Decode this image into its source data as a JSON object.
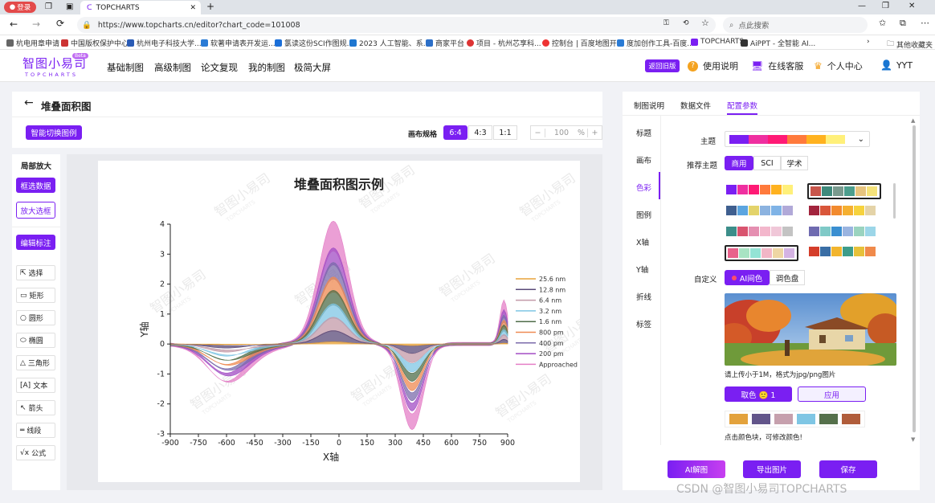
{
  "browser": {
    "login_label": "登录",
    "tab_title": "TOPCHARTS",
    "url": "https://www.topcharts.cn/editor?chart_code=101008",
    "search_placeholder": "点此搜索",
    "bookmarks": [
      "杭电用章申请",
      "中国版权保护中心",
      "杭州电子科技大学...",
      "软著申请表开发运...",
      "氯读这份SCI作图规...",
      "2023 人工智能、系...",
      "商家平台",
      "项目 - 杭州芯享科...",
      "控制台 | 百度地图开...",
      "度加创作工具-百度...",
      "TOPCHARTS",
      "AiPPT - 全智能 AI...",
      "其他收藏夹"
    ]
  },
  "header": {
    "logo_cn": "智图小易司",
    "logo_en": "TOPCHARTS",
    "logo_badge": "Beta",
    "nav": [
      "基础制图",
      "高级制图",
      "论文复现",
      "我的制图",
      "极简大屏"
    ],
    "old_version": "返回旧版",
    "help": "使用说明",
    "service": "在线客服",
    "center": "个人中心",
    "user": "YYT"
  },
  "editor": {
    "back": "←",
    "title": "堆叠面积图",
    "smart_switch": "智能切换图例",
    "ratio_label": "画布规格",
    "ratios": [
      "6:4",
      "4:3",
      "1:1"
    ],
    "zoom_minus": "−",
    "zoom_value": "100",
    "zoom_unit": "%",
    "zoom_plus": "+"
  },
  "left_tools": {
    "title": "局部放大",
    "filter": "框选数据",
    "zoom_box": "放大选框",
    "annotate": "编辑标注",
    "tools": [
      "选择",
      "矩形",
      "圆形",
      "椭圆",
      "三角形",
      "文本",
      "箭头",
      "线段",
      "公式"
    ]
  },
  "chart_data": {
    "type": "area",
    "title": "堆叠面积图示例",
    "xlabel": "X轴",
    "ylabel": "Y轴",
    "xlim": [
      -900,
      900
    ],
    "ylim": [
      -3,
      4
    ],
    "xticks": [
      "-900",
      "-750",
      "-600",
      "-450",
      "-300",
      "-150",
      "0",
      "150",
      "300",
      "450",
      "600",
      "750",
      "900"
    ],
    "yticks": [
      "-3",
      "-2",
      "-1",
      "0",
      "1",
      "2",
      "3",
      "4"
    ],
    "watermark": "智图小易司",
    "watermark_en": "TOPCHARTS",
    "series": [
      {
        "name": "25.6 nm",
        "color": "#e8a33a"
      },
      {
        "name": "12.8 nm",
        "color": "#5a4a78"
      },
      {
        "name": "6.4 nm",
        "color": "#c39aa8"
      },
      {
        "name": "3.2 nm",
        "color": "#7fc6e4"
      },
      {
        "name": "1.6 nm",
        "color": "#4f6d4a"
      },
      {
        "name": "800 pm",
        "color": "#ef8a52"
      },
      {
        "name": "400 pm",
        "color": "#7b6bab"
      },
      {
        "name": "200 pm",
        "color": "#a24cc4"
      },
      {
        "name": "Approached",
        "color": "#e47fc7"
      }
    ]
  },
  "right_panel": {
    "tabs": [
      "制图说明",
      "数据文件",
      "配置参数"
    ],
    "side": [
      "标题",
      "画布",
      "色彩",
      "图例",
      "X轴",
      "Y轴",
      "折线",
      "标签"
    ],
    "theme_label": "主题",
    "theme_colors": [
      "#7a1ff2",
      "#ef2fa0",
      "#ff1a75",
      "#ff7a3c",
      "#ffb21f",
      "#fff07a"
    ],
    "recommend_label": "推荐主题",
    "rec_tabs": [
      "商用",
      "SCI",
      "学术"
    ],
    "palettes": [
      [
        "#7a1ff2",
        "#ef2fa0",
        "#ff1a75",
        "#ff7a3c",
        "#ffb21f",
        "#fff07a"
      ],
      [
        "#c8564b",
        "#3f8a7c",
        "#7a9a8e",
        "#4c9e8d",
        "#e7c47f",
        "#f5e27a"
      ],
      [
        "#3f5f8f",
        "#5ba5e0",
        "#e3d36b",
        "#8cb3e0",
        "#7fb3e6",
        "#b1a9d8"
      ],
      [
        "#a2243d",
        "#d9563a",
        "#f28a2e",
        "#f5b031",
        "#f6d23d",
        "#e4d3a8"
      ],
      [
        "#3c8e8a",
        "#d9546f",
        "#e58fb1",
        "#f3b7cc",
        "#f0c7d8",
        "#c3c3c3"
      ],
      [
        "#6f6bb0",
        "#7fc9c7",
        "#3a8fd1",
        "#9ab4e0",
        "#9ad3bf",
        "#9cd6e8"
      ],
      [
        "#e8628b",
        "#a8e3c3",
        "#93e3d5",
        "#f2b6c6",
        "#eed6a4",
        "#d4b3e3"
      ],
      [
        "#d43d2a",
        "#3a6ea5",
        "#f2b52e",
        "#3d9c8a",
        "#e6c13a",
        "#f08a4b"
      ]
    ],
    "custom_label": "自定义",
    "ai_tab": "AI间色",
    "palette_tab": "调色盘",
    "upload_hint": "请上传小于1M，格式为jpg/png图片",
    "pick_btn": "取色 🙂 1",
    "apply_btn": "应用",
    "picked": [
      "#e3a23c",
      "#62558a",
      "#c6a0ad",
      "#7fc6e4",
      "#55704b",
      "#b05c3a"
    ],
    "click_hint": "点击颜色块，可修改颜色!"
  },
  "footer": {
    "ai_btn": "AI解图",
    "export_btn": "导出图片",
    "save_btn": "保存",
    "watermark": "CSDN @智图小易司TOPCHARTS"
  }
}
